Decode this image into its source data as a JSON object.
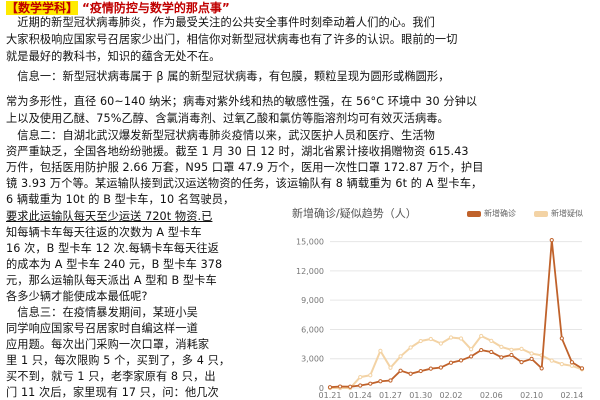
{
  "doc": {
    "tag": "【数学学科】",
    "title": "“疫情防控与数学的那点事”",
    "lines": [
      "　近期的新型冠状病毒肺炎，作为最受关注的公共安全事件时刻牵动着人们的心。我们",
      "大家积极响应国家号召居家少出门，相信你对新型冠状病毒也有了许多的认识。眼前的一切",
      "就是最好的教科书，知识的蕴含无处不在。",
      "　信息一：新型冠状病毒属于 β 属的新型冠状病毒，有包膜，颗粒呈现为圆形或椭圆形，",
      "常为多形性，直径 60~140 纳米；病毒对紫外线和热的敏感性强，在 56°C 环境中 30 分钟以",
      "上以及使用乙醚、75%乙醇、含氯消毒剂、过氧乙酸和氯仿等脂溶剂均可有效灭活病毒。",
      "　信息二：自湖北武汉爆发新型冠状病毒肺炎疫情以来，武汉医护人员和医疗、生活物",
      "资严重缺乏，全国各地纷纷驰援。截至 1 月 30 日 12 时，湖北省累计接收捐赠物资 615.43",
      "万件，包括医用防护服 2.66 万套，N95 口罩 47.9 万个，医用一次性口罩 172.87 万个，护目",
      "镜 3.93 万个等。某运输队接到武汉运送物资的任务，该运输队有 8 辆载重为 6t 的 A 型卡车，",
      "6 辆载重为 10t 的 B 型卡车，10 名驾驶员，",
      "要求此运输队每天至少运送 720t 物资.已",
      "知每辆卡车每天往返的次数为 A 型卡车",
      "16 次，B 型卡车 12 次.每辆卡车每天往返",
      "的成本为 A 型卡车 240 元，B 型卡车 378",
      "元，那么运输队每天派出 A 型和 B 型卡车",
      "各多少辆才能使成本最低呢?",
      "　信息三：在疫情暴发期间，某班小吴",
      "同学响应国家号召居家时自编这样一道",
      "应用题。每次出门采购一次口罩，消耗家",
      "里 1 只，每次限购 5 个，买到了，多 4 只，",
      "买不到，就亏 1 只，老李家原有 8 只，出",
      "门 11 次后，家里现有 17 只，问：他几次"
    ]
  },
  "chart_data": {
    "type": "line",
    "title": "新增确诊/疑似趋势（人）",
    "x": [
      "01.21",
      "01.22",
      "01.23",
      "01.24",
      "01.25",
      "01.26",
      "01.27",
      "01.28",
      "01.29",
      "01.30",
      "01.31",
      "02.01",
      "02.02",
      "02.03",
      "02.04",
      "02.05",
      "02.06",
      "02.07",
      "02.08",
      "02.09",
      "02.10",
      "02.11",
      "02.12",
      "02.13",
      "02.14",
      "02.15"
    ],
    "xticks": [
      "01.21",
      "01.24",
      "01.27",
      "01.30",
      "02.02",
      "02.06",
      "02.10",
      "02.14"
    ],
    "ylim": [
      0,
      16500
    ],
    "yticks": [
      "0",
      "3,000",
      "6,000",
      "9,000",
      "12,000",
      "15,000"
    ],
    "series": [
      {
        "name": "新增确诊",
        "color": "#c0622b",
        "values": [
          77,
          149,
          131,
          259,
          444,
          688,
          769,
          1771,
          1459,
          1737,
          1982,
          2102,
          2590,
          2829,
          3235,
          3887,
          3694,
          3143,
          3385,
          2652,
          2984,
          2015,
          15152,
          5090,
          2641,
          2009
        ]
      },
      {
        "name": "新增疑似",
        "color": "#f3d3a5",
        "values": [
          0,
          0,
          0,
          1118,
          1309,
          3806,
          2077,
          3248,
          4148,
          4812,
          5019,
          4562,
          5173,
          5072,
          3971,
          5328,
          4833,
          4214,
          3916,
          4008,
          3536,
          3342,
          2807,
          2450,
          2277,
          1918
        ]
      }
    ]
  }
}
